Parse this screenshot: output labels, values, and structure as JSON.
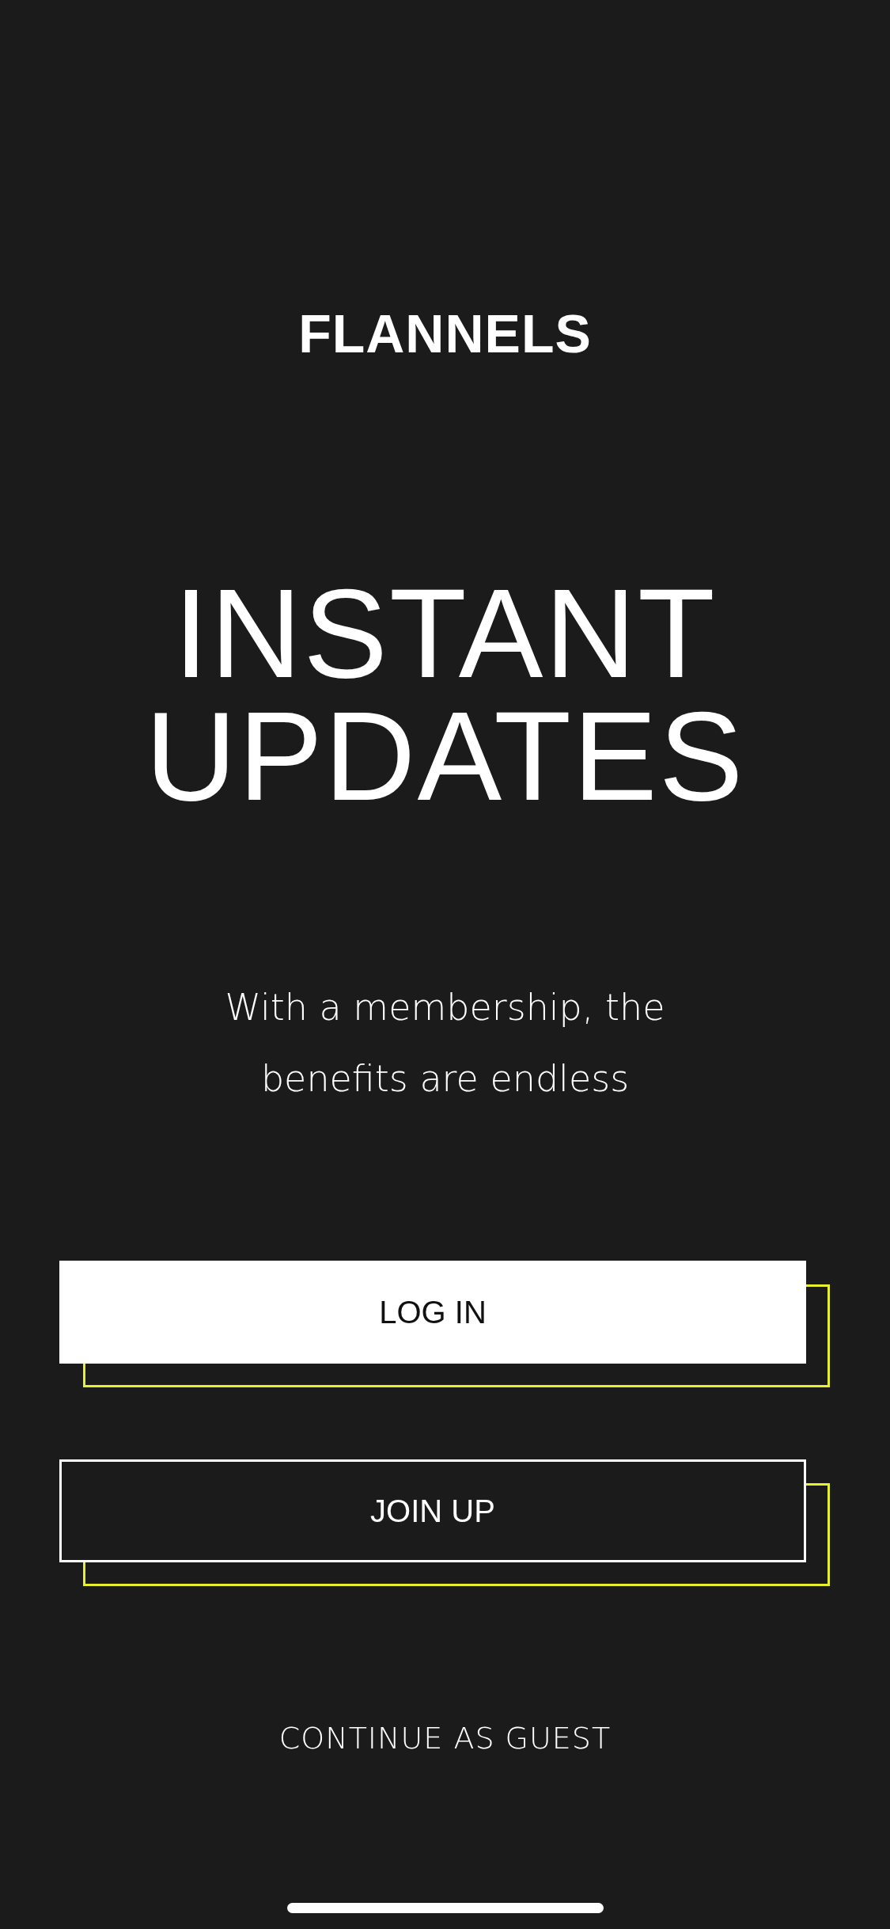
{
  "logo": "FLANNELS",
  "headline": [
    "INSTANT",
    "UPDATES"
  ],
  "subtitle": "With a membership, the benefits are endless",
  "buttons": [
    {
      "label": "LOG IN",
      "kind": "filled"
    },
    {
      "label": "JOIN UP",
      "kind": "outline"
    }
  ],
  "guest_link": "CONTINUE AS GUEST"
}
